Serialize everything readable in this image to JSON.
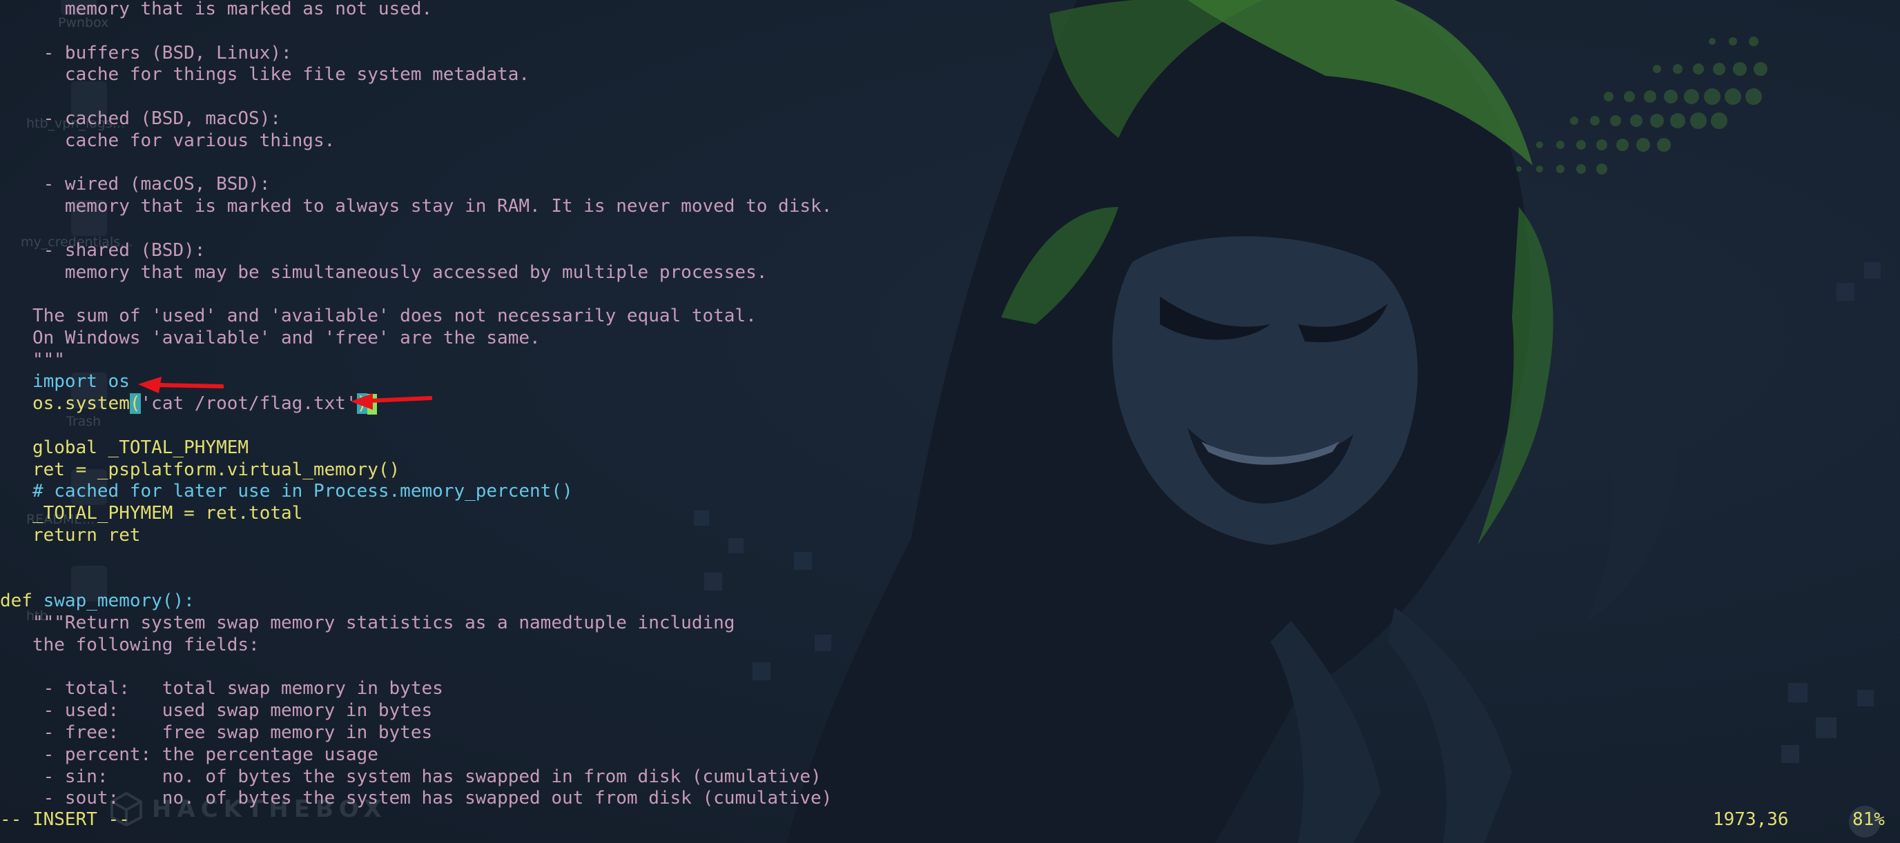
{
  "desktop": {
    "icons": [
      {
        "label": "Pwnbox",
        "icon": "home-icon"
      },
      {
        "label": "htb_vpn_logs...",
        "icon": "folder-icon"
      },
      {
        "label": "my_credentials...",
        "icon": "file-icon"
      },
      {
        "label": "Trash",
        "icon": "trash-icon"
      },
      {
        "label": "README...",
        "icon": "file-icon"
      },
      {
        "label": "htb",
        "icon": "file-icon"
      }
    ],
    "watermark": "HACKTHEBOX"
  },
  "editor": {
    "lines": [
      {
        "indent": "      ",
        "text": "memory that is marked as not used."
      },
      {
        "indent": "",
        "text": ""
      },
      {
        "indent": "    ",
        "text": "- buffers (BSD, Linux):"
      },
      {
        "indent": "      ",
        "text": "cache for things like file system metadata."
      },
      {
        "indent": "",
        "text": ""
      },
      {
        "indent": "    ",
        "text": "- cached (BSD, macOS):"
      },
      {
        "indent": "      ",
        "text": "cache for various things."
      },
      {
        "indent": "",
        "text": ""
      },
      {
        "indent": "    ",
        "text": "- wired (macOS, BSD):"
      },
      {
        "indent": "      ",
        "text": "memory that is marked to always stay in RAM. It is never moved to disk."
      },
      {
        "indent": "",
        "text": ""
      },
      {
        "indent": "    ",
        "text": "- shared (BSD):"
      },
      {
        "indent": "      ",
        "text": "memory that may be simultaneously accessed by multiple processes."
      },
      {
        "indent": "",
        "text": ""
      },
      {
        "indent": "   ",
        "text": "The sum of 'used' and 'available' does not necessarily equal total."
      },
      {
        "indent": "   ",
        "text": "On Windows 'available' and 'free' are the same."
      },
      {
        "indent": "   ",
        "text": "\"\"\""
      }
    ],
    "code_import": {
      "indent": "   ",
      "keyword": "import",
      "module": " os"
    },
    "code_system": {
      "indent": "   ",
      "call": "os.system",
      "open_paren": "(",
      "arg": "'cat /root/flag.txt'",
      "close_paren": ")"
    },
    "code_global": {
      "indent": "   ",
      "keyword": "global",
      "name": " _TOTAL_PHYMEM"
    },
    "code_ret": {
      "indent": "   ",
      "text": "ret = _psplatform.virtual_memory()"
    },
    "code_comment": {
      "indent": "   ",
      "text": "# cached for later use in Process.memory_percent()"
    },
    "code_total": {
      "indent": "   ",
      "text": "_TOTAL_PHYMEM = ret.total"
    },
    "code_return": {
      "indent": "   ",
      "keyword": "return",
      "name": " ret"
    },
    "code_def": {
      "keyword": "def",
      "name": "swap_memory",
      "sig": "():"
    },
    "doc2": [
      {
        "indent": "   ",
        "text": "\"\"\"Return system swap memory statistics as a namedtuple including"
      },
      {
        "indent": "   ",
        "text": "the following fields:"
      },
      {
        "indent": "",
        "text": ""
      },
      {
        "indent": "    ",
        "text": "- total:   total swap memory in bytes"
      },
      {
        "indent": "    ",
        "text": "- used:    used swap memory in bytes"
      },
      {
        "indent": "    ",
        "text": "- free:    free swap memory in bytes"
      },
      {
        "indent": "    ",
        "text": "- percent: the percentage usage"
      },
      {
        "indent": "    ",
        "text": "- sin:     no. of bytes the system has swapped in from disk (cumulative)"
      },
      {
        "indent": "    ",
        "text": "- sout:    no. of bytes the system has swapped out from disk (cumulative)"
      }
    ]
  },
  "status": {
    "mode": "-- INSERT --",
    "position": "1973,36",
    "percent": "81%"
  },
  "colors": {
    "keyword": "#e3df6e",
    "builtin": "#65c7e6",
    "string": "#c79bb9",
    "cursor": "#8ee25a",
    "arrow": "#e8141b"
  }
}
